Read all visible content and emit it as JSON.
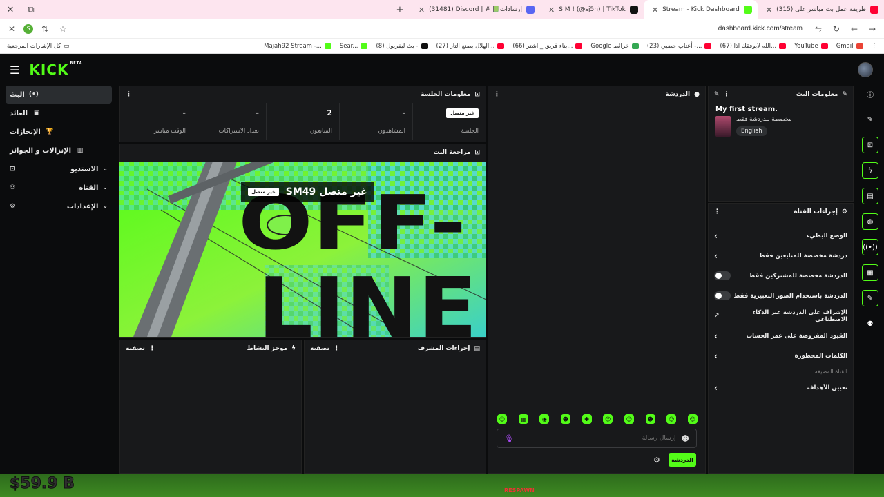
{
  "browser": {
    "window_controls": {
      "close": "✕",
      "restore": "⧉",
      "minimize": "—"
    },
    "tab_add": "+",
    "tabs": [
      {
        "title": "(31481) Discord | # 📗إرشادات",
        "fav": "#5865f2",
        "active": false
      },
      {
        "title": "S M ! (@sj5h) | TikTok",
        "fav": "#111111",
        "active": false
      },
      {
        "title": "Stream - Kick Dashboard",
        "fav": "#53fc18",
        "active": true
      },
      {
        "title": "(315) طريقة عمل بث مباشر على",
        "fav": "#ff0033",
        "active": false
      }
    ],
    "url": "dashboard.kick.com/stream",
    "profile_initial": "S",
    "bookmarks_folder": "كل الإشارات المرجعية",
    "bookmarks": [
      {
        "label": "Majah92 Stream -...",
        "fav": "#53fc18"
      },
      {
        "label": "Sear...",
        "fav": "#53fc18"
      },
      {
        "label": "(8) بث ليفربول -",
        "fav": "#111111"
      },
      {
        "label": "(27) الهلال يصنع التار...",
        "fav": "#ff0033"
      },
      {
        "label": "(66) بناء فريق _ اشتر...",
        "fav": "#ff0033"
      },
      {
        "label": "Google خرائط",
        "fav": "#34a853"
      },
      {
        "label": "(23) أعتاب حضيي -...",
        "fav": "#ff0033"
      },
      {
        "label": "(67) الله لايوفقك اذا...",
        "fav": "#ff0033"
      },
      {
        "label": "YouTube",
        "fav": "#ff0033"
      },
      {
        "label": "Gmail",
        "fav": "#ea4335"
      }
    ]
  },
  "kick": {
    "logo": "KICK",
    "logo_badge": "BETA",
    "sidebar": [
      {
        "label": "البث",
        "icon": "(•)",
        "active": true,
        "chevron": false,
        "lead": ""
      },
      {
        "label": "العائد",
        "icon": "▣",
        "active": false,
        "chevron": false,
        "lead": ""
      },
      {
        "label": "الإنجازات",
        "icon": "🏆",
        "active": false,
        "chevron": false,
        "lead": ""
      },
      {
        "label": "الإنزالات و الجوائز",
        "icon": "▥",
        "active": false,
        "chevron": false,
        "lead": ""
      },
      {
        "label": "الاستديو",
        "icon": "⌄",
        "active": false,
        "chevron": true,
        "lead": "⊡"
      },
      {
        "label": "القناة",
        "icon": "⌄",
        "active": false,
        "chevron": true,
        "lead": "⚇"
      },
      {
        "label": "الإعدادات",
        "icon": "⌄",
        "active": false,
        "chevron": true,
        "lead": "⚙"
      }
    ],
    "session": {
      "title": "معلومات الجلسة",
      "stats": [
        {
          "value": "غير متصل",
          "label": "الجلسة",
          "pill": true
        },
        {
          "value": "-",
          "label": "المشاهدون",
          "pill": false
        },
        {
          "value": "2",
          "label": "المتابعون",
          "pill": false
        },
        {
          "value": "-",
          "label": "تعداد الاشتراكات",
          "pill": false
        },
        {
          "value": "-",
          "label": "الوقت مباشر",
          "pill": false
        }
      ]
    },
    "preview": {
      "title": "مراجعة البث",
      "offline_text": "OFF-LINE",
      "stream_title": "غير متصل SM49",
      "status_pill": "غير متصل"
    },
    "activity": {
      "title": "موجز النشاط",
      "filter": "تصفية"
    },
    "mod_actions": {
      "title": "إجراءات المشرف",
      "filter": "تصفية"
    },
    "chat": {
      "title": "الدردشة",
      "placeholder": "إرسال رسالة",
      "send_label": "الدردشة",
      "emotes": [
        "☺",
        "▦",
        "◉",
        "☻",
        "✚",
        "☺",
        "☺",
        "☻",
        "☺",
        "☺"
      ]
    },
    "stream_info": {
      "title": "معلومات البث",
      "stream_title": "My first stream.",
      "category": "مخصصة للدردشة فقط",
      "language": "English"
    },
    "channel_actions": {
      "title": "إجراءات القناة",
      "items": [
        {
          "label": "الوضع البطيء",
          "kind": "arrow"
        },
        {
          "label": "دردشة مخصصة للمتابعين فقط",
          "kind": "arrow"
        },
        {
          "label": "الدردشة مخصصة للمشتركين فقط",
          "kind": "toggle"
        },
        {
          "label": "الدردشة باستخدام الصور التعبيرية فقط",
          "kind": "toggle"
        },
        {
          "label": "الإشراف على الدردشة عبر الذكاء الاصطناعي",
          "kind": "external"
        },
        {
          "label": "القيود المفروضة على عمر الحساب",
          "kind": "arrow"
        },
        {
          "label": "الكلمات المحظورة",
          "kind": "arrow"
        }
      ],
      "section_label": "القناة المضيفة",
      "goals_label": "تعيين الأهداف"
    },
    "rail": [
      "ⓘ",
      "✎",
      "⊡",
      "ϟ",
      "▤",
      "◍",
      "((•))",
      "▦",
      "✎",
      "⚉"
    ]
  },
  "game_strip": {
    "money": "$59.9 B",
    "respawn": "RESPAWN"
  }
}
